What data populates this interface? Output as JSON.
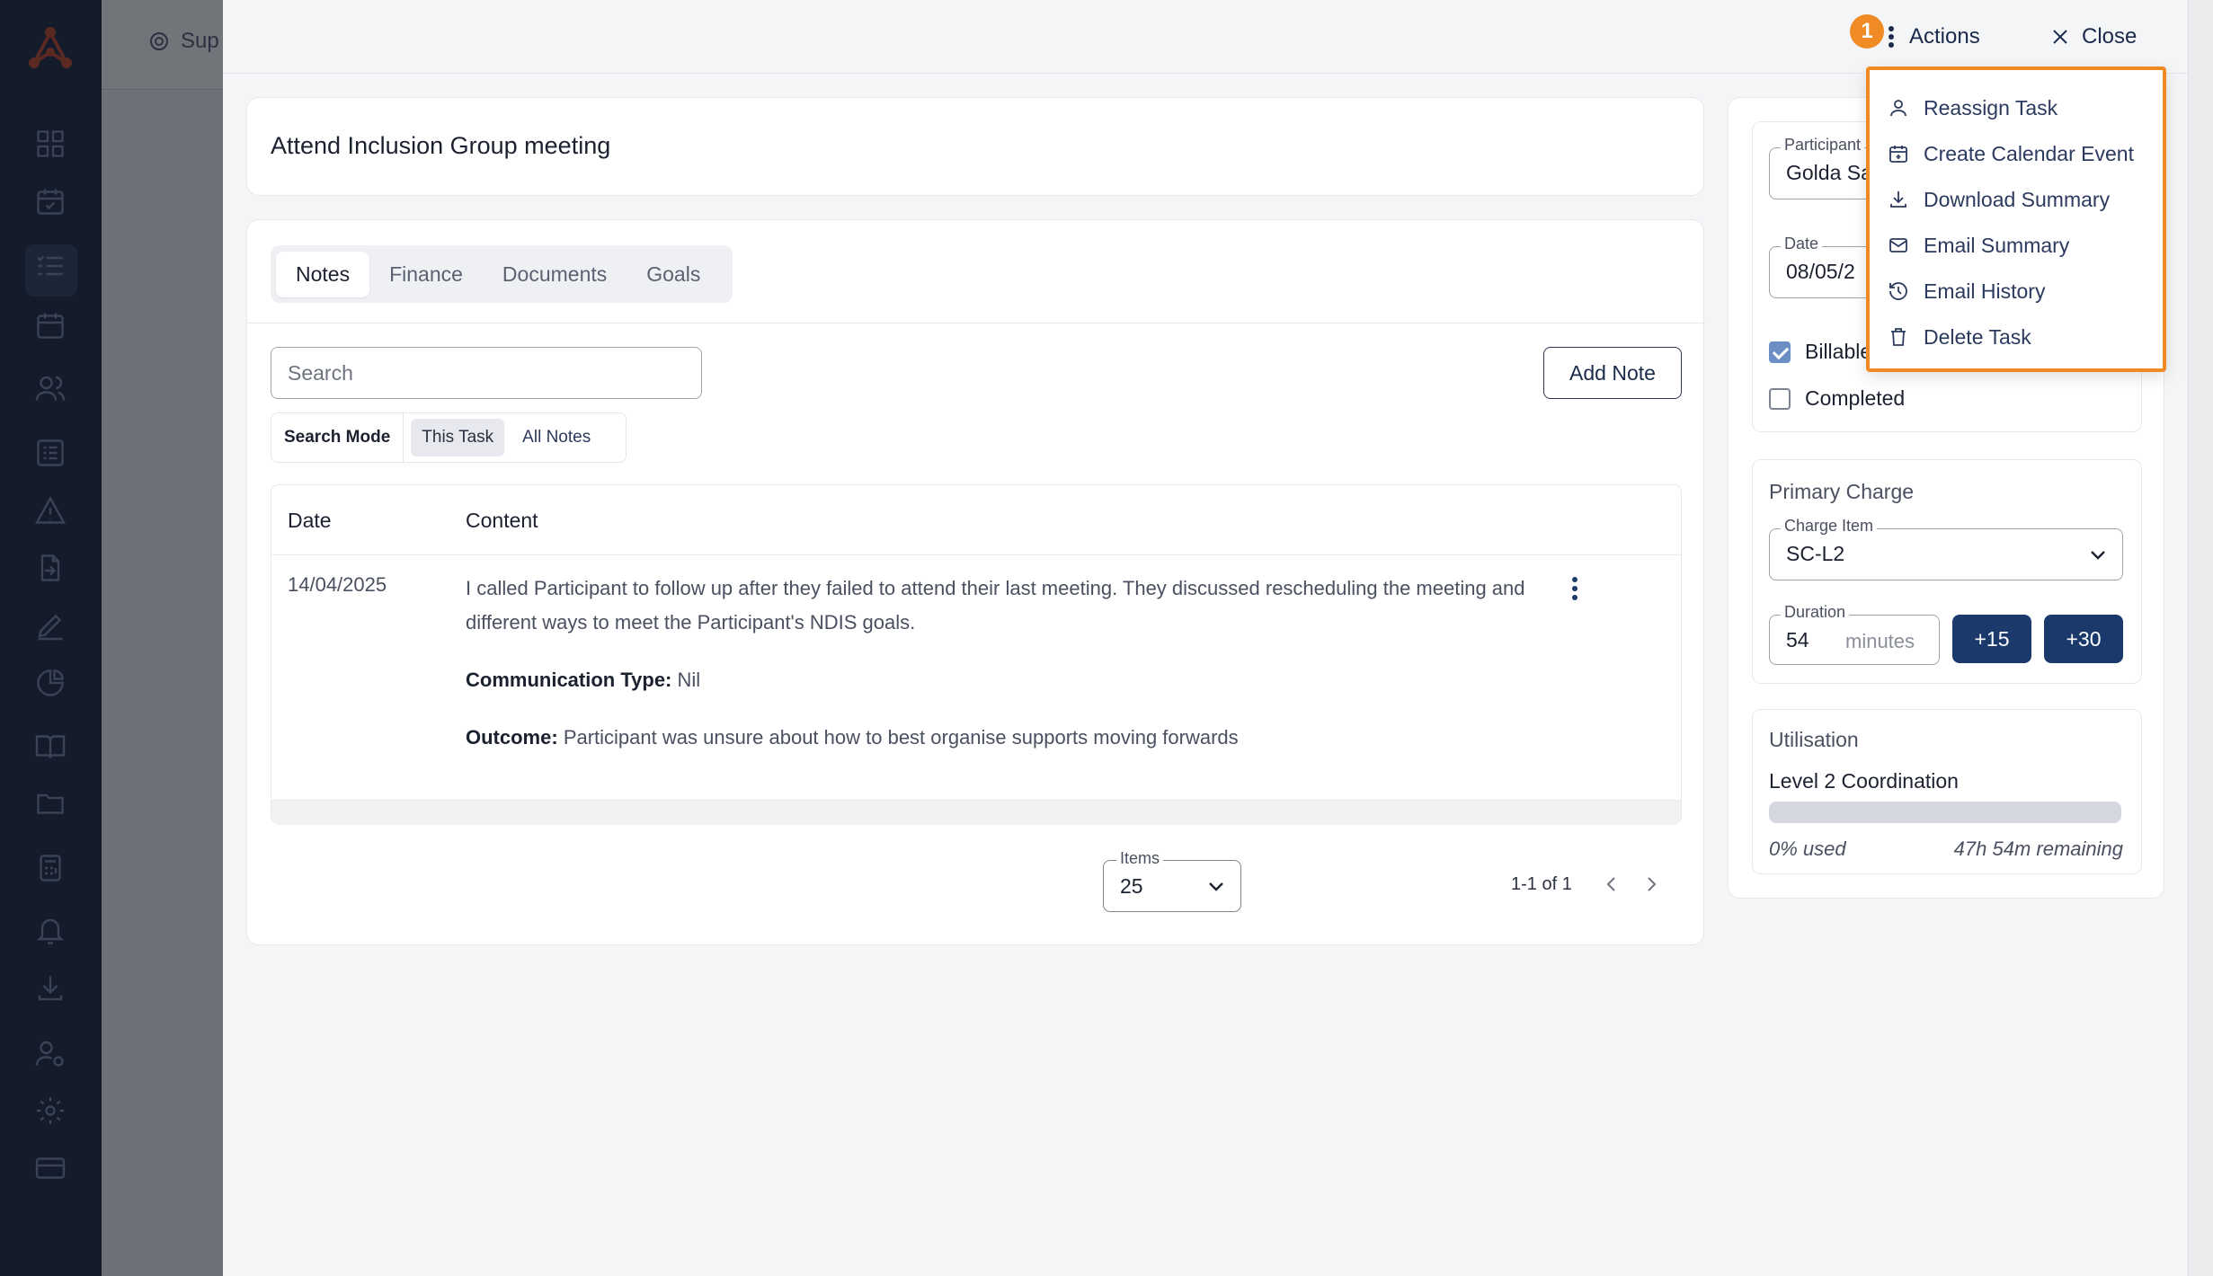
{
  "background": {
    "breadcrumb": "Sup"
  },
  "header": {
    "badge": "1",
    "actions_label": "Actions",
    "close_label": "Close"
  },
  "task": {
    "title": "Attend Inclusion Group meeting"
  },
  "tabs": [
    {
      "label": "Notes",
      "active": true
    },
    {
      "label": "Finance",
      "active": false
    },
    {
      "label": "Documents",
      "active": false
    },
    {
      "label": "Goals",
      "active": false
    }
  ],
  "notes": {
    "search_placeholder": "Search",
    "add_note_label": "Add Note",
    "search_mode": {
      "label": "Search Mode",
      "options": [
        "This Task",
        "All Notes"
      ],
      "selected": "This Task"
    },
    "columns": [
      "Date",
      "Content"
    ],
    "rows": [
      {
        "date": "14/04/2025",
        "content": "I called Participant to follow up after they failed to attend their last meeting. They discussed rescheduling the meeting and different ways to meet the Participant's NDIS goals.",
        "communication_type_label": "Communication Type:",
        "communication_type": "Nil",
        "outcome_label": "Outcome:",
        "outcome": "Participant was unsure about how to best organise supports moving forwards"
      }
    ],
    "pagination": {
      "items_label": "Items",
      "items_value": "25",
      "range": "1-1 of 1"
    }
  },
  "details": {
    "participant_label": "Participant",
    "participant_value": "Golda Sa",
    "date_label": "Date",
    "date_value": "08/05/2",
    "billable_label": "Billable",
    "billable": true,
    "completed_label": "Completed",
    "completed": false
  },
  "primary_charge": {
    "title": "Primary Charge",
    "charge_item_label": "Charge Item",
    "charge_item_value": "SC-L2",
    "duration_label": "Duration",
    "duration_value": "54",
    "duration_unit": "minutes",
    "add15": "+15",
    "add30": "+30"
  },
  "utilisation": {
    "title": "Utilisation",
    "item": "Level 2 Coordination",
    "used_fraction": 0,
    "used_text": "0% used",
    "remaining_text": "47h 54m remaining"
  },
  "actions_menu": {
    "items": [
      {
        "label": "Reassign Task",
        "icon": "user-icon"
      },
      {
        "label": "Create Calendar Event",
        "icon": "calendar-plus-icon"
      },
      {
        "label": "Download Summary",
        "icon": "download-icon"
      },
      {
        "label": "Email Summary",
        "icon": "mail-icon"
      },
      {
        "label": "Email History",
        "icon": "history-icon"
      },
      {
        "label": "Delete Task",
        "icon": "trash-icon"
      }
    ]
  },
  "colors": {
    "accent": "#f08a24",
    "primary": "#1b3a6b",
    "sidebar": "#141b2b"
  }
}
